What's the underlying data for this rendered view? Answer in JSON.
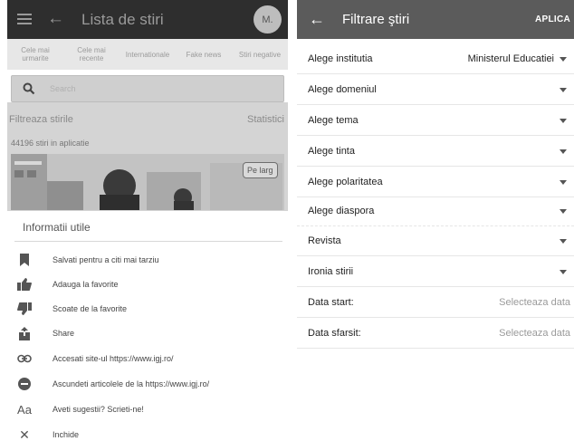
{
  "left": {
    "appbar": {
      "title": "Lista de stiri",
      "avatar": "M."
    },
    "tabs": [
      {
        "label": "Cele mai urmarite"
      },
      {
        "label": "Cele mai recente"
      },
      {
        "label": "Internationale"
      },
      {
        "label": "Fake news"
      },
      {
        "label": "Stiri negative"
      }
    ],
    "search": {
      "placeholder": "Search"
    },
    "filter_label": "Filtreaza stirile",
    "stats_label": "Statistici",
    "count_text": "44196 stiri in aplicatie",
    "photo_badge": "Pe larg",
    "sheet": {
      "title": "Informatii utile",
      "items": [
        {
          "icon": "bookmark-icon",
          "label": "Salvati pentru a citi mai tarziu"
        },
        {
          "icon": "thumbs-up-icon",
          "label": "Adauga la favorite"
        },
        {
          "icon": "thumbs-down-icon",
          "label": "Scoate de la favorite"
        },
        {
          "icon": "share-icon",
          "label": "Share"
        },
        {
          "icon": "link-icon",
          "label": "Accesati site-ul https://www.igj.ro/"
        },
        {
          "icon": "minus-circle-icon",
          "label": "Ascundeti articolele de la https://www.igj.ro/"
        },
        {
          "icon": "text-aa-icon",
          "label": "Aveti sugestii? Scrieti-ne!"
        },
        {
          "icon": "close-icon",
          "label": "Inchide"
        }
      ]
    }
  },
  "right": {
    "appbar": {
      "title": "Filtrare ştiri",
      "apply": "APLICA"
    },
    "rows": [
      {
        "label": "Alege institutia",
        "value": "Ministerul Educatiei"
      },
      {
        "label": "Alege domeniul",
        "value": ""
      },
      {
        "label": "Alege tema",
        "value": ""
      },
      {
        "label": "Alege tinta",
        "value": ""
      },
      {
        "label": "Alege polaritatea",
        "value": ""
      },
      {
        "label": "Alege diaspora",
        "value": ""
      },
      {
        "label": "Revista",
        "value": ""
      },
      {
        "label": "Ironia stirii",
        "value": ""
      }
    ],
    "date_start": {
      "label": "Data start:",
      "placeholder": "Selecteaza data"
    },
    "date_end": {
      "label": "Data sfarsit:",
      "placeholder": "Selecteaza data"
    }
  },
  "colors": {
    "left_appbar": "#2e2e2e",
    "right_appbar": "#5b5b5b",
    "scrim": "#d4d4d4"
  }
}
